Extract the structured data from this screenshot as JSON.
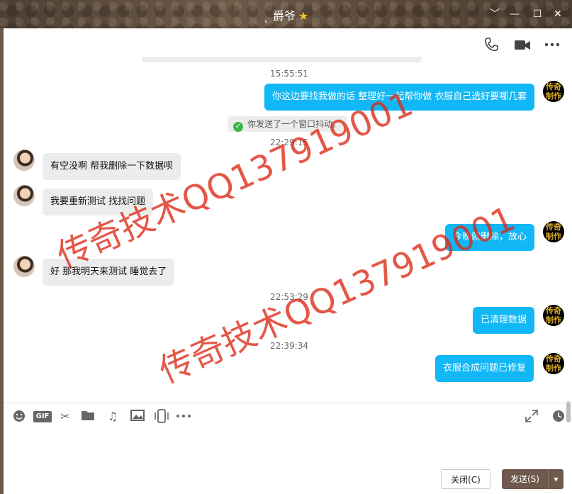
{
  "window": {
    "title": "爵爷",
    "controls": {
      "dropdown": "﹀",
      "minimize": "—",
      "maximize": "☐",
      "close": "✕"
    }
  },
  "header": {
    "icons": [
      "phone-icon",
      "video-icon",
      "more-icon"
    ]
  },
  "chat": {
    "times": [
      "15:55:51",
      "22:29:15",
      "22:53:29",
      "22:39:34"
    ],
    "system_notice": "你发送了一个窗口抖动。",
    "messages": [
      {
        "side": "right",
        "text": "你这边要找我做的话 整理好一起帮你做 衣服自己选好要哪几套"
      },
      {
        "side": "left",
        "text": "有空没啊  帮我删除一下数据呗"
      },
      {
        "side": "left",
        "text": "我要重新测试 找找问题"
      },
      {
        "side": "right",
        "text": "今晚就删除，放心"
      },
      {
        "side": "left",
        "text": "好  那我明天来测试  睡觉去了"
      },
      {
        "side": "right",
        "text": "已清理数据"
      },
      {
        "side": "right",
        "text": "衣服合成问题已修复"
      }
    ],
    "avatar_logo_text": "传奇制作"
  },
  "watermarks": [
    "传奇技术QQ137919001",
    "传奇技术QQ137919001"
  ],
  "toolbar": {
    "tools": [
      "emoji-icon",
      "gif-icon",
      "scissors-icon",
      "folder-icon",
      "music-icon",
      "image-icon",
      "shake-icon",
      "more-icon",
      "expand-icon",
      "history-icon"
    ],
    "gif_label": "GIF"
  },
  "buttons": {
    "close": "关闭(C)",
    "send": "发送(S)",
    "send_arrow": "▾"
  }
}
